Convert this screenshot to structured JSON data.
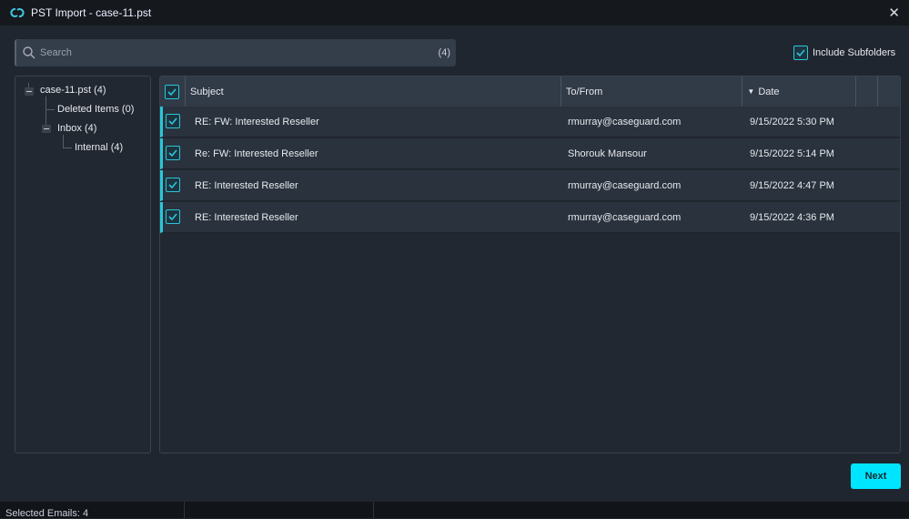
{
  "window": {
    "title": "PST Import - case-11.pst"
  },
  "search": {
    "placeholder": "Search",
    "count": "(4)"
  },
  "include_subfolders": {
    "label": "Include Subfolders",
    "checked": true
  },
  "tree": {
    "root": "case-11.pst (4)",
    "deleted": "Deleted Items (0)",
    "inbox": "Inbox (4)",
    "internal": "Internal (4)"
  },
  "grid": {
    "headers": {
      "subject": "Subject",
      "tofrom": "To/From",
      "date": "Date"
    },
    "rows": [
      {
        "subject": "RE: FW: Interested Reseller",
        "tofrom": "rmurray@caseguard.com",
        "date": "9/15/2022 5:30 PM"
      },
      {
        "subject": "Re: FW: Interested Reseller",
        "tofrom": "Shorouk Mansour",
        "date": "9/15/2022 5:14 PM"
      },
      {
        "subject": "RE: Interested Reseller",
        "tofrom": "rmurray@caseguard.com",
        "date": "9/15/2022 4:47 PM"
      },
      {
        "subject": "RE: Interested Reseller",
        "tofrom": "rmurray@caseguard.com",
        "date": "9/15/2022 4:36 PM"
      }
    ]
  },
  "next_label": "Next",
  "status": "Selected Emails: 4",
  "colors": {
    "accent": "#00e5ff",
    "check": "#29c7d8"
  }
}
